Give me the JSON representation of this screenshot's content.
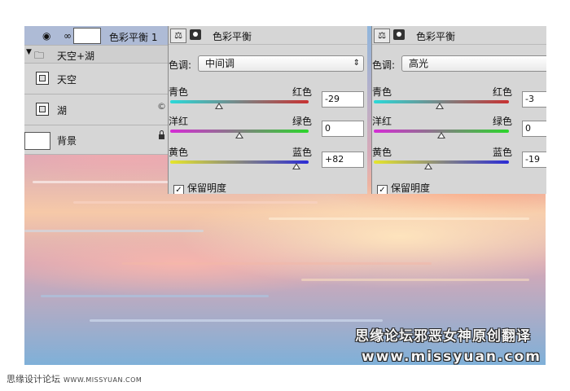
{
  "layers": {
    "adjustment_label": "色彩平衡 1",
    "group_label": "天空+湖",
    "items": [
      {
        "label": "天空"
      },
      {
        "label": "湖"
      },
      {
        "label": "背景"
      }
    ],
    "fx_glyph": "©"
  },
  "panels": [
    {
      "title": "色彩平衡",
      "tone_label": "色调:",
      "tone_value": "中间调",
      "sliders": [
        {
          "left": "青色",
          "right": "红色",
          "value": -29
        },
        {
          "left": "洋红",
          "right": "绿色",
          "value": 0
        },
        {
          "left": "黄色",
          "right": "蓝色",
          "value": 82
        }
      ],
      "slider_display": [
        "-29",
        "0",
        "+82"
      ],
      "preserve_label": "保留明度",
      "preserve_checked": true
    },
    {
      "title": "色彩平衡",
      "tone_label": "色调:",
      "tone_value": "高光",
      "sliders": [
        {
          "left": "青色",
          "right": "红色",
          "value": -3
        },
        {
          "left": "洋红",
          "right": "绿色",
          "value": 0
        },
        {
          "left": "黄色",
          "right": "蓝色",
          "value": -19
        }
      ],
      "slider_display": [
        "-3",
        "0",
        "-19"
      ],
      "preserve_label": "保留明度",
      "preserve_checked": true
    }
  ],
  "slider_range": [
    -100,
    100
  ],
  "watermark": {
    "cn": "思缘论坛邪恶女神原创翻译",
    "url": "www.missyuan.com"
  },
  "footer": {
    "site": "思缘设计论坛",
    "url": "WWW.MISSYUAN.COM"
  },
  "icons": {
    "eye": "eye-icon",
    "link": "chain-link-icon",
    "folder": "folder-icon",
    "balance": "color-balance-icon",
    "mask": "mask-icon",
    "lock": "lock-icon"
  }
}
